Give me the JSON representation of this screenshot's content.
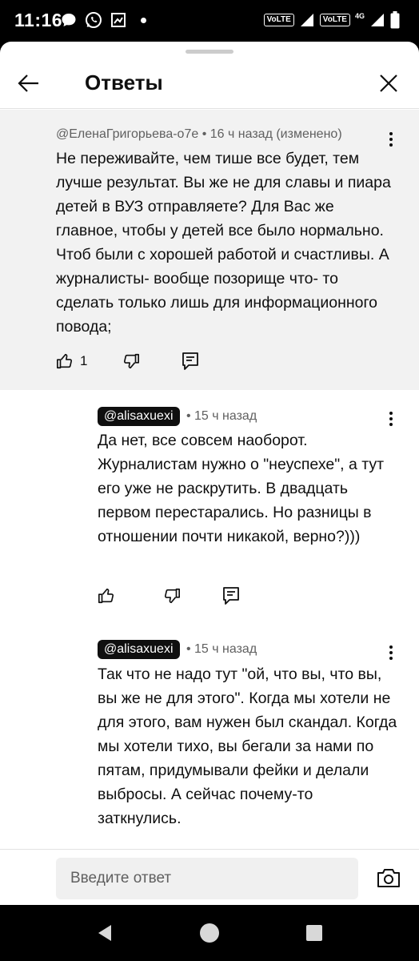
{
  "status": {
    "time": "11:16",
    "volte1": "VoLTE",
    "volte2": "VoLTE",
    "net": "4G"
  },
  "header": {
    "title": "Ответы"
  },
  "parent_comment": {
    "author": "@ЕленаГригорьева-о7е",
    "meta": "• 16 ч назад (изменено)",
    "text": "Не переживайте, чем тише все будет, тем лучше результат. Вы же не для славы и пиара детей в ВУЗ отправляете? Для Вас же главное, чтобы у детей все было нормально. Чтоб были с хорошей работой и счастливы. А журналисты- вообще позорище что- то сделать только лишь для информационного повода;",
    "likes": "1"
  },
  "replies": [
    {
      "author": "@alisaxuexi",
      "meta": "• 15 ч назад",
      "text": "Да нет, все совсем наоборот. Журналистам нужно о \"неуспехе\", а тут его уже не раскрутить. В двадцать первом перестарались. Но разницы в отношении почти никакой, верно?)))"
    },
    {
      "author": "@alisaxuexi",
      "meta": "• 15 ч назад",
      "text": "Так что не надо тут \"ой, что вы, что вы, вы же не для этого\". Когда мы хотели не для этого, вам нужен был скандал. Когда мы хотели тихо, вы бегали за нами по пятам, придумывали фейки и делали выбросы. А сейчас почему-то заткнулись."
    }
  ],
  "reply_box": {
    "placeholder": "Введите ответ"
  },
  "icons": {
    "back": "arrow-left-icon",
    "close": "close-icon",
    "more": "more-vert-icon",
    "like": "thumb-up-icon",
    "dislike": "thumb-down-icon",
    "reply": "reply-icon",
    "camera": "camera-icon"
  }
}
